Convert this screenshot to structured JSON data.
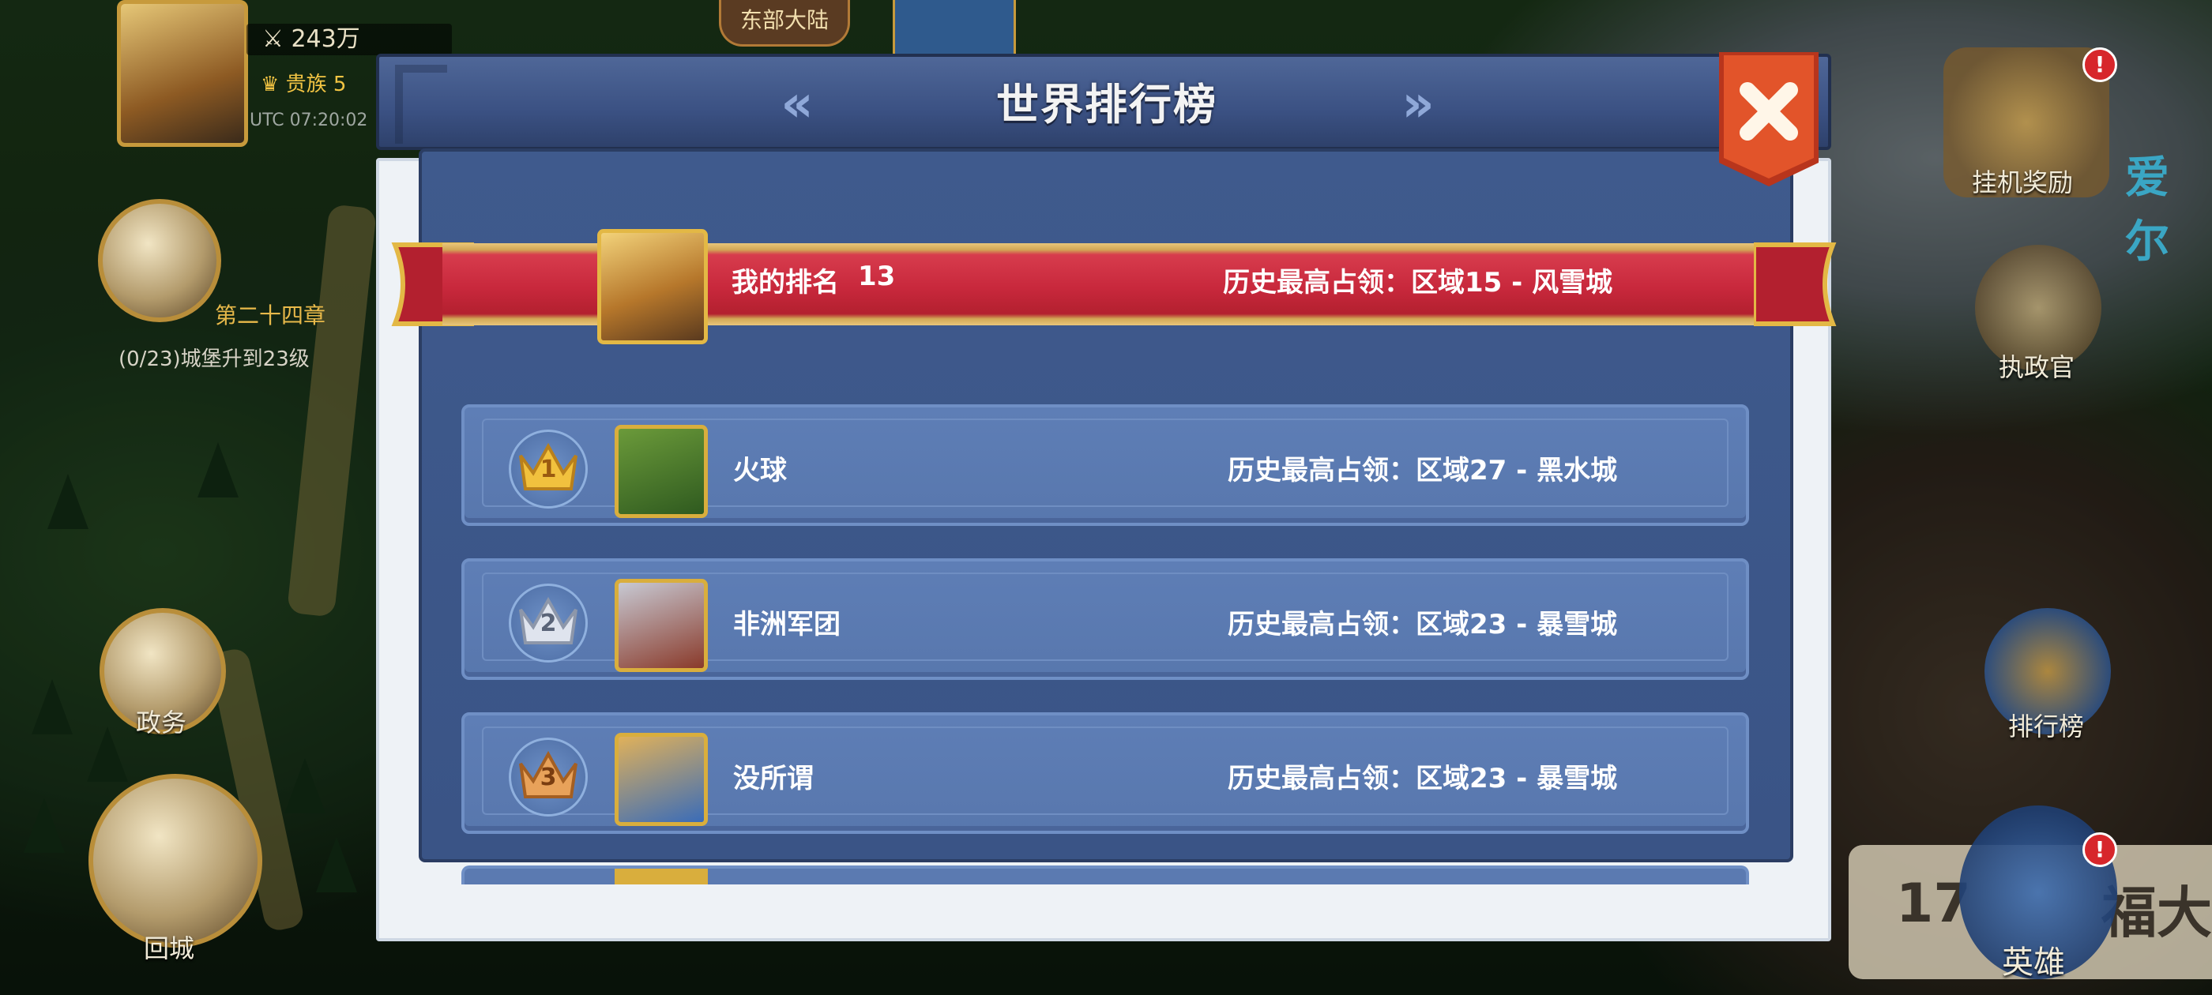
{
  "background": {
    "power": "243万",
    "noble": "贵族 5",
    "utc": "UTC 07:20:02",
    "region_tab": "东部大陆",
    "quest_title": "第二十四章",
    "quest_desc": "(0/23)城堡升到23级",
    "left_buttons": [
      "政务",
      "回城"
    ],
    "right_buttons": [
      "挂机奖励",
      "执政官",
      "排行榜",
      "英雄"
    ],
    "partial_text_right": "爱尔",
    "welfare_number": "17",
    "welfare_text": "福大"
  },
  "panel": {
    "title": "世界排行榜",
    "prev_icon": "double-chevron-left",
    "next_icon": "double-chevron-right",
    "close_icon": "close-x",
    "colors": {
      "header": "#4a6295",
      "inner_bg": "#3d5789",
      "row_bg": "#5b7ab1",
      "banner_red": "#c8283c",
      "gold": "#e3b845",
      "close_orange": "#e2542a"
    }
  },
  "my_rank": {
    "label": "我的排名",
    "rank": "13",
    "territory": "历史最高占领：区域15 - 风雪城"
  },
  "rankings": [
    {
      "rank": "1",
      "crown": "gold",
      "name": "火球",
      "territory": "历史最高占领：区域27 - 黑水城",
      "avatar_colors": [
        "#6b9a3a",
        "#2f5a1f"
      ]
    },
    {
      "rank": "2",
      "crown": "silver",
      "name": "非洲军团",
      "territory": "历史最高占领：区域23 - 暴雪城",
      "avatar_colors": [
        "#c7c9d3",
        "#8a3a2a"
      ]
    },
    {
      "rank": "3",
      "crown": "bronze",
      "name": "没所谓",
      "territory": "历史最高占领：区域23 - 暴雪城",
      "avatar_colors": [
        "#e0b15a",
        "#3a6cb8"
      ]
    }
  ]
}
